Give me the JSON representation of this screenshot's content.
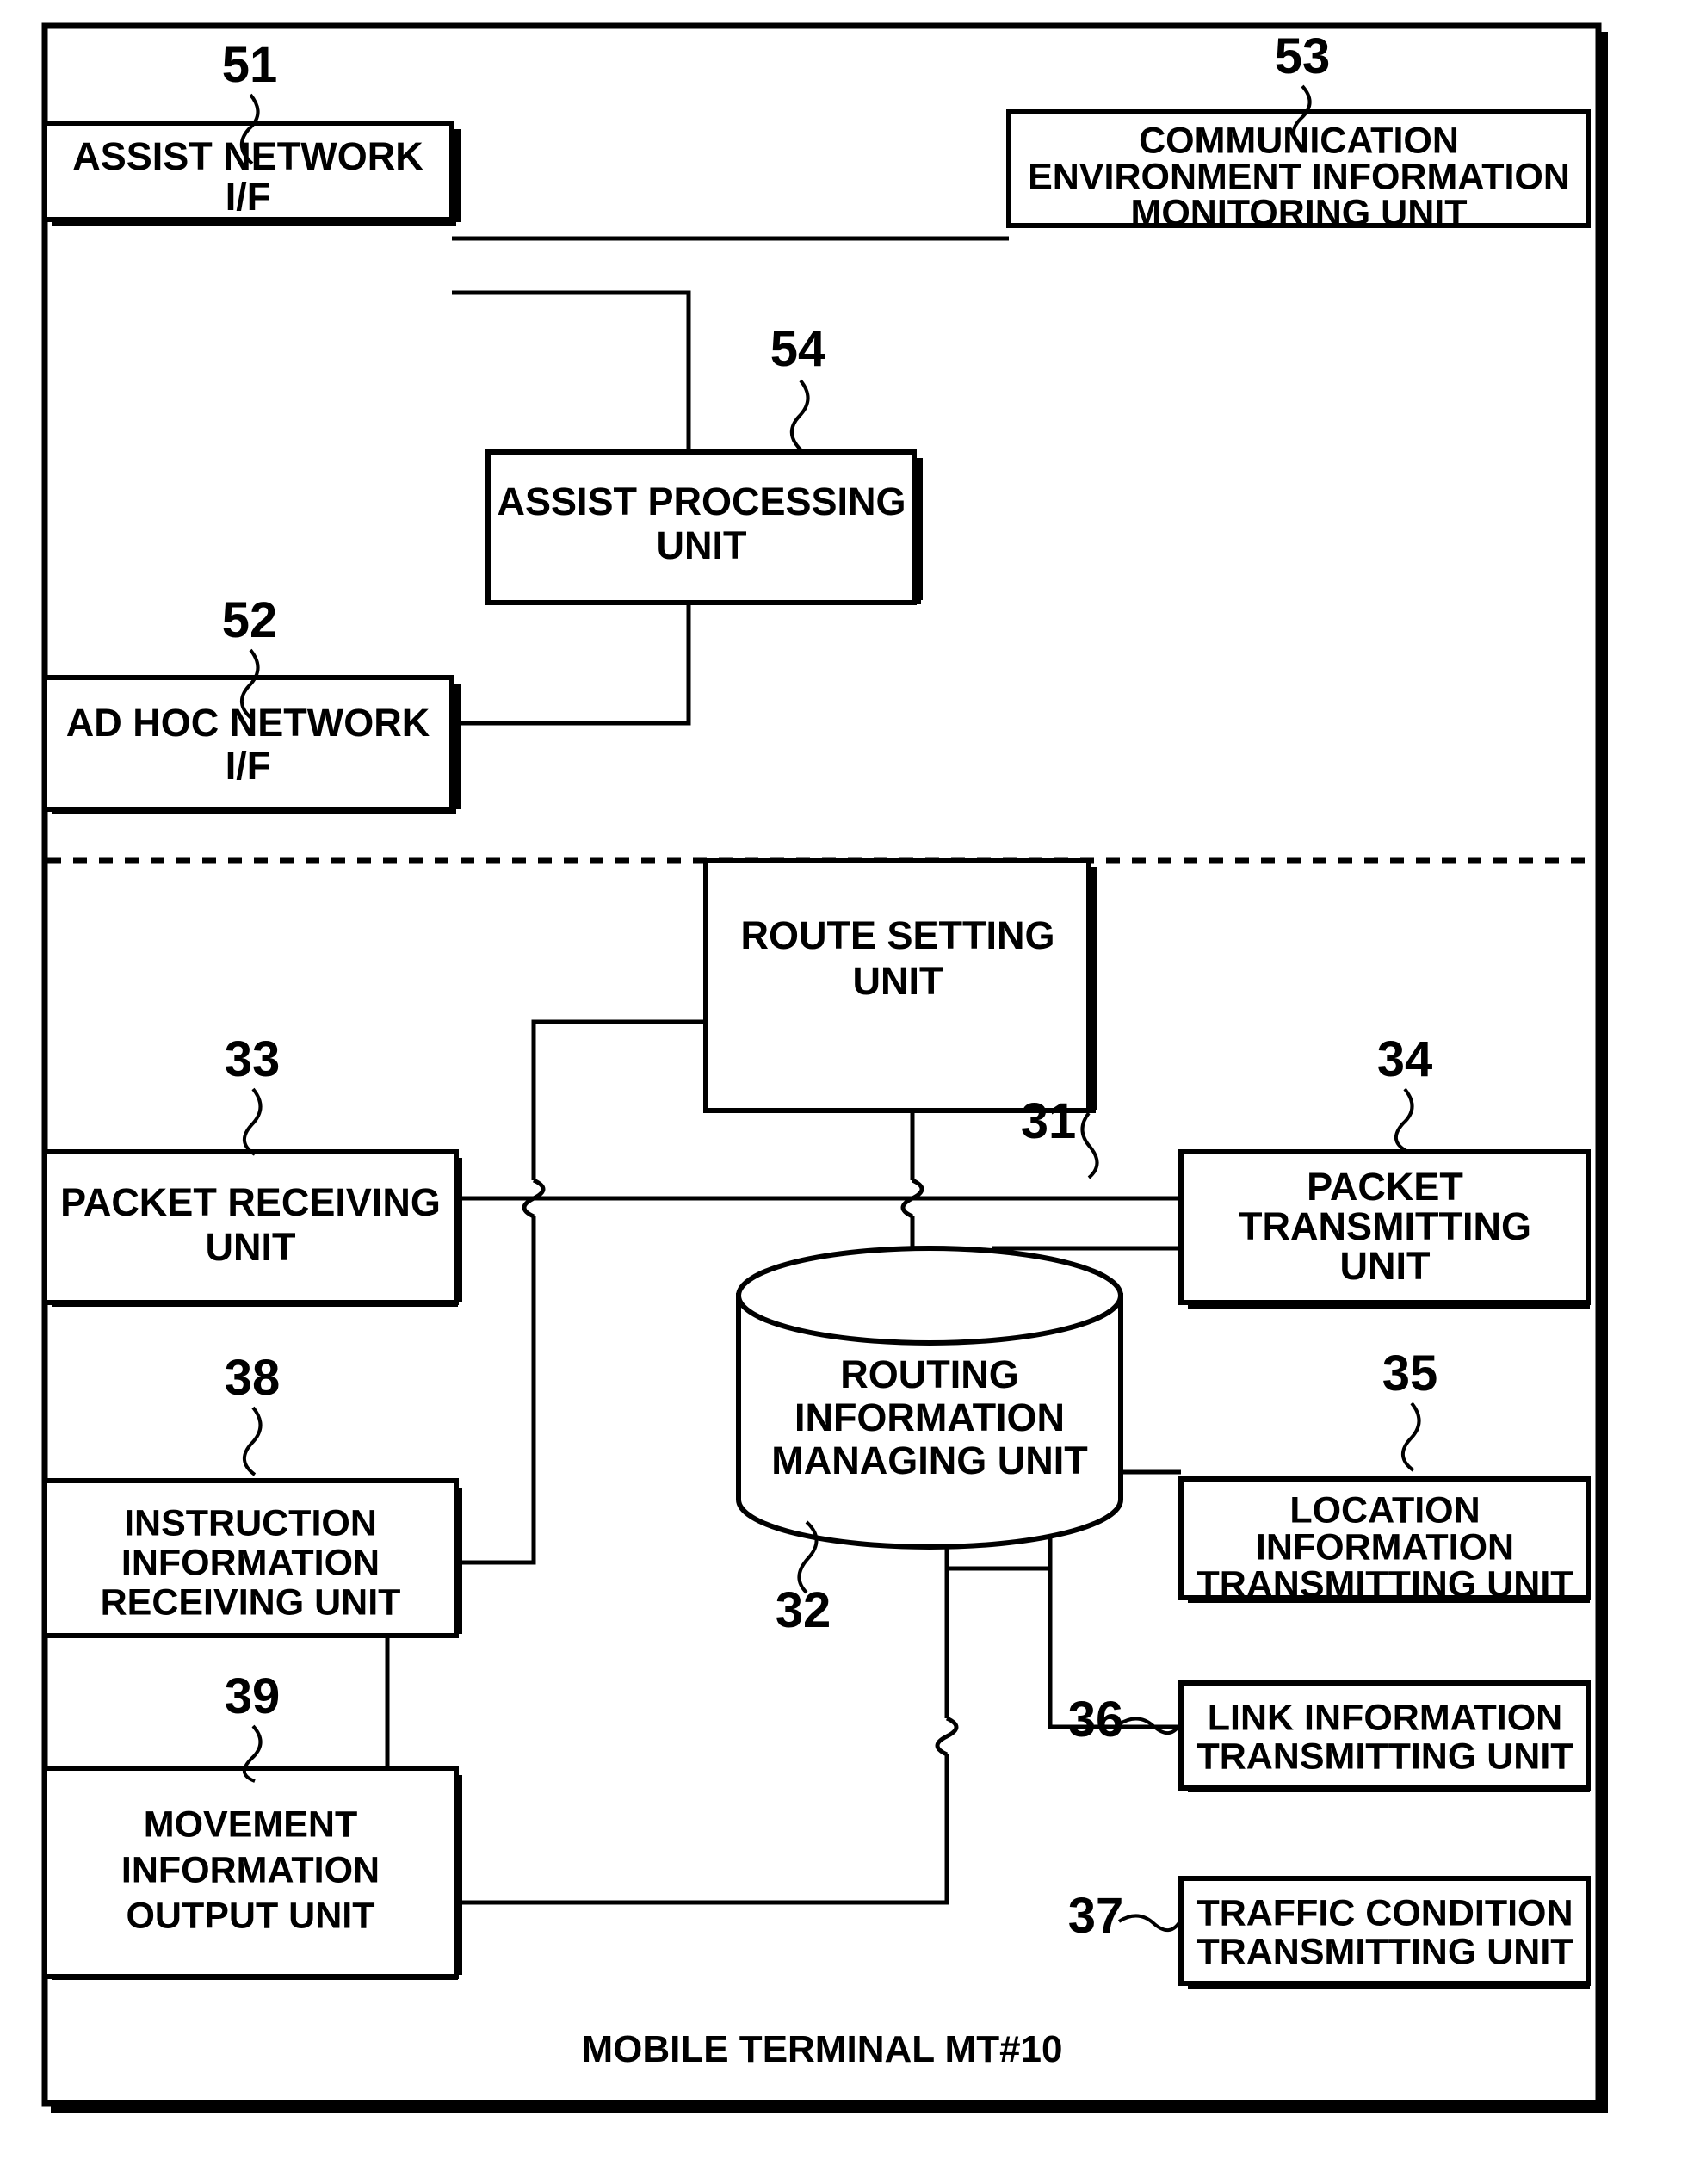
{
  "figure": {
    "caption": "MOBILE TERMINAL MT#10",
    "accent_color": "#000000",
    "background_color": "#ffffff"
  },
  "blocks": {
    "assist_network_if": {
      "ref": "51",
      "line1": "ASSIST  NETWORK",
      "line2": "I/F"
    },
    "ad_hoc_network_if": {
      "ref": "52",
      "line1": "AD  HOC  NETWORK",
      "line2": "I/F"
    },
    "comm_env_monitor": {
      "ref": "53",
      "line1": "COMMUNICATION",
      "line2": "ENVIRONMENT  INFORMATION",
      "line3": "MONITORING UNIT"
    },
    "assist_processing": {
      "ref": "54",
      "line1": "ASSIST  PROCESSING",
      "line2": "UNIT"
    },
    "route_setting": {
      "ref": "31",
      "line1": "ROUTE  SETTING",
      "line2": "UNIT"
    },
    "routing_info_managing": {
      "ref": "32",
      "line1": "ROUTING",
      "line2": "INFORMATION",
      "line3": "MANAGING UNIT"
    },
    "packet_receiving": {
      "ref": "33",
      "line1": "PACKET RECEIVING",
      "line2": "UNIT"
    },
    "packet_transmitting": {
      "ref": "34",
      "line1": "PACKET",
      "line2": "TRANSMITTING",
      "line3": "UNIT"
    },
    "location_info_transmitting": {
      "ref": "35",
      "line1": "LOCATION",
      "line2": "INFORMATION",
      "line3": "TRANSMITTING UNIT"
    },
    "link_info_transmitting": {
      "ref": "36",
      "line1": "LINK INFORMATION",
      "line2": "TRANSMITTING UNIT"
    },
    "traffic_condition_transmitting": {
      "ref": "37",
      "line1": "TRAFFIC CONDITION",
      "line2": "TRANSMITTING UNIT"
    },
    "instruction_info_receiving": {
      "ref": "38",
      "line1": "INSTRUCTION",
      "line2": "INFORMATION",
      "line3": "RECEIVING UNIT"
    },
    "movement_info_output": {
      "ref": "39",
      "line1": "MOVEMENT",
      "line2": "INFORMATION",
      "line3": "OUTPUT UNIT"
    }
  }
}
